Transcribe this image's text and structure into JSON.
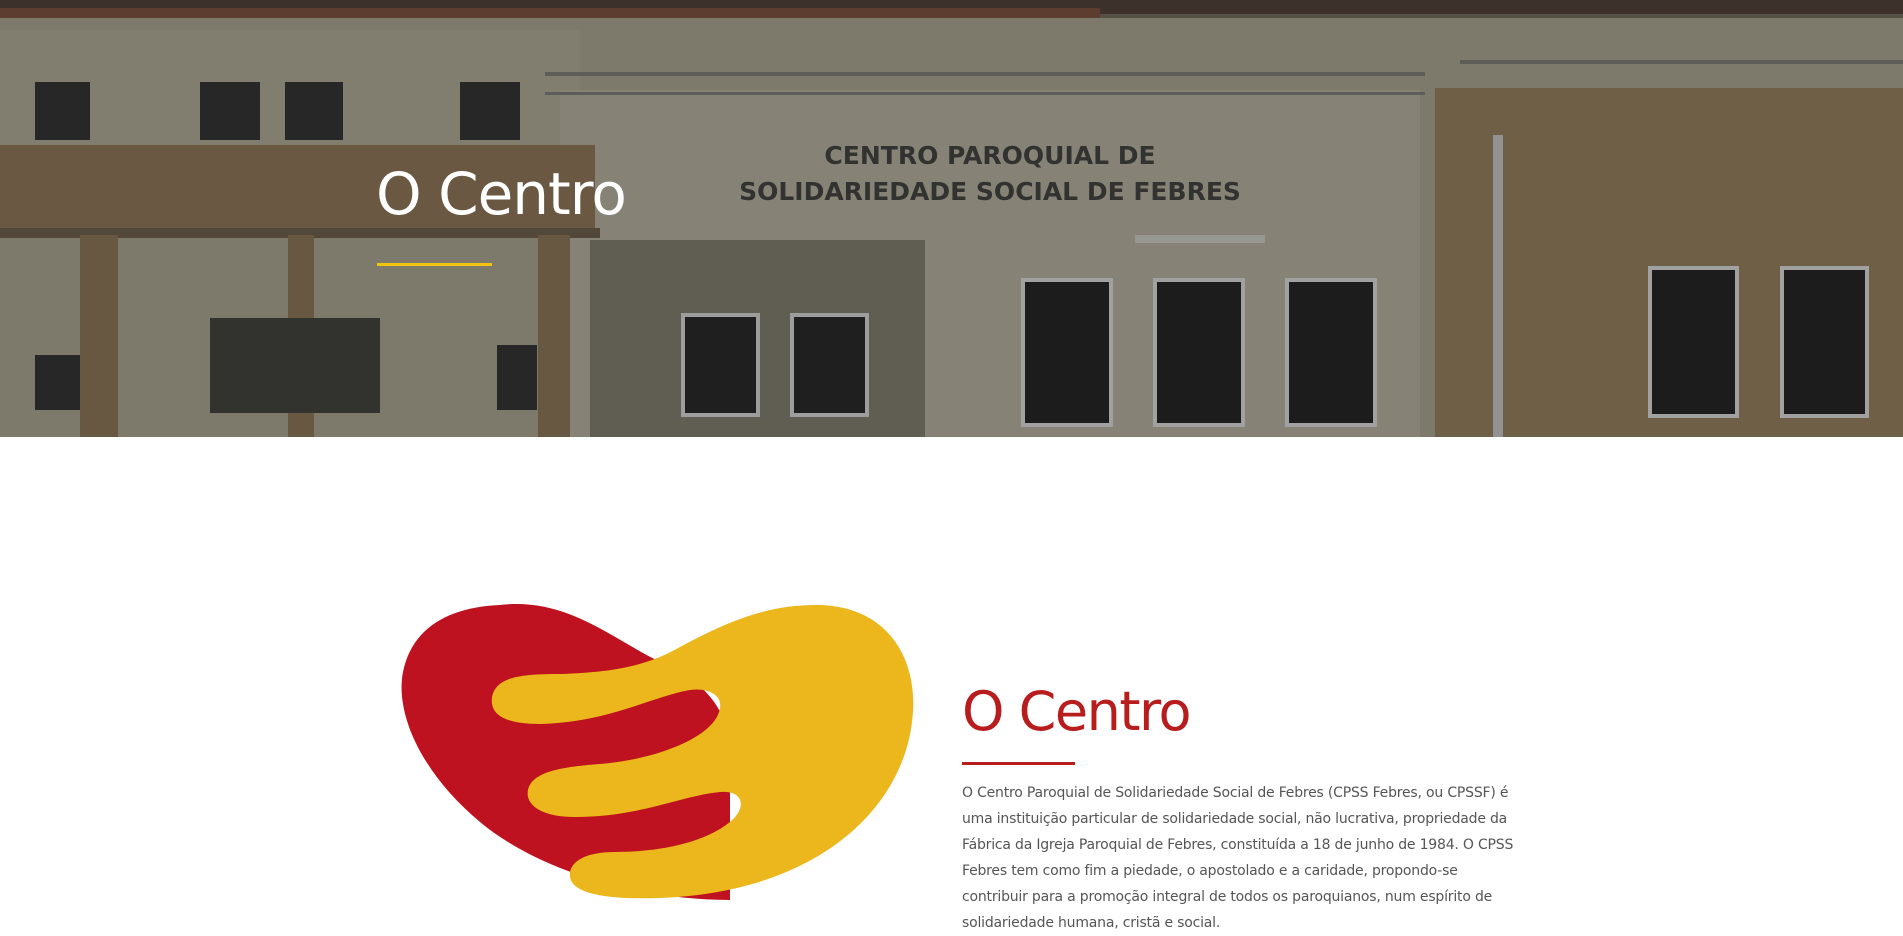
{
  "colors": {
    "accent_yellow": "#F1C40F",
    "brand_red": "#B91C1C",
    "logo_red": "#BE1220",
    "logo_yellow": "#ECB71C",
    "body_text": "#555555"
  },
  "hero": {
    "title": "O Centro",
    "sign_line_1": "CENTRO PAROQUIAL DE",
    "sign_line_2": "SOLIDARIEDADE SOCIAL DE FEBRES"
  },
  "about": {
    "title": "O Centro",
    "paragraph": "O Centro Paroquial de Solidariedade Social de Febres (CPSS Febres, ou CPSSF) é uma instituição particular de solidariedade social, não lucrativa, propriedade da Fábrica da Igreja Paroquial de Febres, constituída a 18 de junho de 1984. O CPSS Febres tem como fim a piedade, o apostolado e a caridade, propondo-se contribuir para a promoção integral de todos os paroquianos, num espírito de solidariedade humana, cristã e social."
  }
}
